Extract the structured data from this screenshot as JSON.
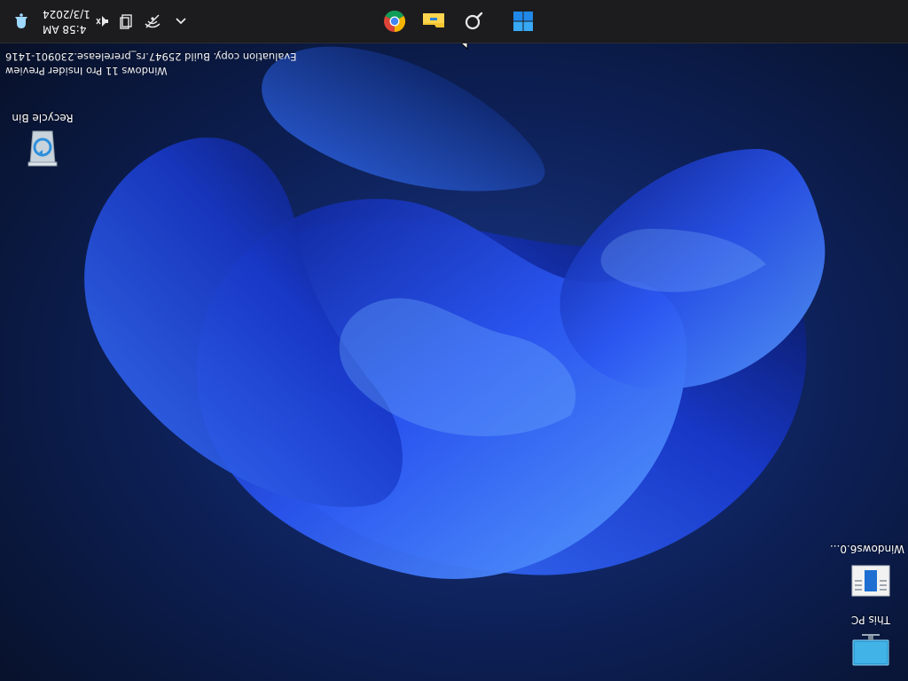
{
  "desktop": {
    "icons": [
      {
        "label": "This PC"
      },
      {
        "label": "Windows6.0..."
      },
      {
        "label": "Recycle Bin"
      }
    ]
  },
  "watermark": {
    "line1": "Windows 11 Pro Insider Preview",
    "line2": "Evaluation copy. Build 25947.rs_prerelease.230901-1416"
  },
  "taskbar": {
    "apps": [
      "start-icon",
      "search-icon",
      "file-explorer-icon",
      "chrome-icon"
    ],
    "tray_icons": [
      "chevron-up-icon",
      "network-icon",
      "volume-icon",
      "speaker-icon"
    ],
    "clock": {
      "time": "4:58 AM",
      "date": "1/3/2024"
    },
    "notification_icon": "bell-icon"
  },
  "colors": {
    "taskbar": "#1c1c1f",
    "accent": "#2f6bff",
    "wallpaper_bg": "#0a1530"
  }
}
